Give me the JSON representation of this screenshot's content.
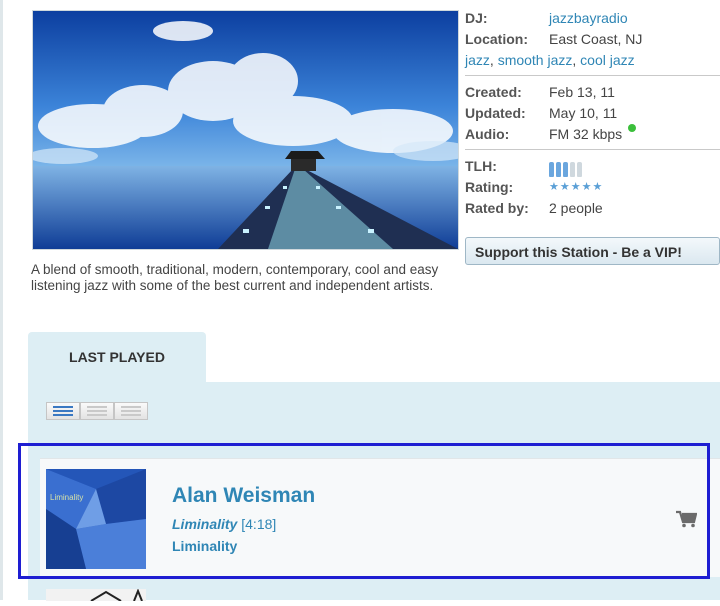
{
  "description": "A blend of smooth, traditional, modern, contemporary, cool and easy listening jazz with some of the best current and independent artists.",
  "info": {
    "dj_label": "DJ:",
    "dj_value": "jazzbayradio",
    "location_label": "Location:",
    "location_value": "East Coast, NJ",
    "genres": [
      "jazz",
      "smooth jazz",
      "cool jazz"
    ],
    "created_label": "Created:",
    "created_value": "Feb 13, 11",
    "updated_label": "Updated:",
    "updated_value": "May 10, 11",
    "audio_label": "Audio:",
    "audio_value": "FM 32 kbps",
    "tlh_label": "TLH:",
    "tlh_level": 3,
    "tlh_max": 5,
    "rating_label": "Rating:",
    "rating_stars": 5,
    "rated_by_label": "Rated by:",
    "rated_by_value": "2 people"
  },
  "vip_button": "Support this Station - Be a VIP!",
  "tabs": {
    "last_played": "LAST PLAYED"
  },
  "track": {
    "artist": "Alan Weisman",
    "title": "Liminality",
    "duration": "[4:18]",
    "album": "Liminality",
    "cover_text": "Liminality"
  },
  "colors": {
    "link": "#2f86b5",
    "panel_bg": "#ddeef4",
    "highlight": "#1e1ed2",
    "status_online": "#3bbf3b"
  },
  "icons": [
    "list-view-icon",
    "compact-view-icon",
    "detail-view-icon",
    "cart-icon"
  ]
}
